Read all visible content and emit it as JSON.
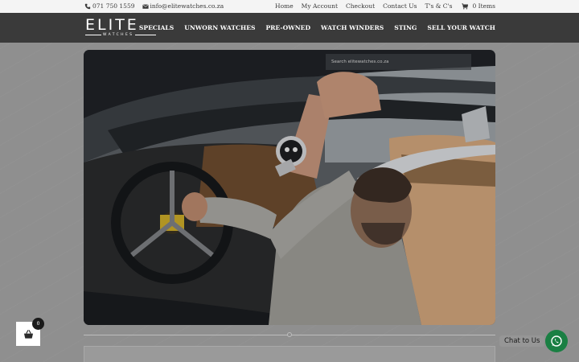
{
  "topbar": {
    "phone": "071 750 1559",
    "email": "info@elitewatches.co.za",
    "links": [
      "Home",
      "My Account",
      "Checkout",
      "Contact Us",
      "T's & C's"
    ],
    "cart_label": "0 Items"
  },
  "header": {
    "logo_main": "ELITE",
    "logo_sub": "WATCHES",
    "nav": [
      "SPECIALS",
      "UNWORN WATCHES",
      "PRE-OWNED",
      "WATCH WINDERS",
      "STING",
      "SELL YOUR WATCH"
    ]
  },
  "search": {
    "placeholder": "Search elitewatches.co.za"
  },
  "cart_widget": {
    "count": "0"
  },
  "chat": {
    "label": "Chat to Us"
  },
  "colors": {
    "header_bg": "#3a3a3a",
    "topbar_bg": "#f4f4f4",
    "chat_green": "#1a7f43"
  }
}
